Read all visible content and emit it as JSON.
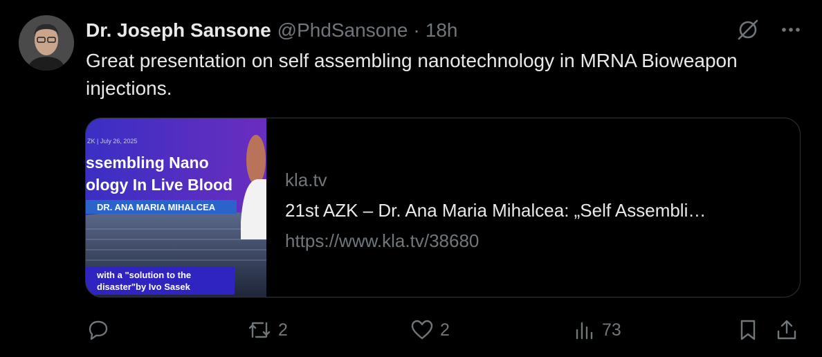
{
  "author": {
    "name": "Dr. Joseph Sansone",
    "handle": "@PhdSansone",
    "separator": "·",
    "time": "18h"
  },
  "tweet": {
    "text": "Great presentation on self assembling nanotechnology in MRNA Bioweapon injections."
  },
  "card": {
    "thumbnail": {
      "date_line": "ZK | July 26, 2025",
      "title_line1": "ssembling Nano",
      "title_line2": "ology In Live Blood",
      "presenter": "DR. ANA MARIA MIHALCEA",
      "footer_line1": "with a \"solution to the",
      "footer_line2": "disaster\"by Ivo Sasek"
    },
    "domain": "kla.tv",
    "title": "21st AZK – Dr. Ana Maria Mihalcea: „Self Assembli…",
    "url": "https://www.kla.tv/38680"
  },
  "actions": {
    "reply_count": "",
    "retweet_count": "2",
    "like_count": "2",
    "view_count": "73"
  },
  "icons": [
    "grok-icon",
    "more-icon",
    "reply-icon",
    "retweet-icon",
    "like-icon",
    "views-icon",
    "bookmark-icon",
    "share-icon"
  ],
  "colors": {
    "background": "#000000",
    "text": "#e7e9ea",
    "muted": "#71767b",
    "border": "#2f3336"
  }
}
